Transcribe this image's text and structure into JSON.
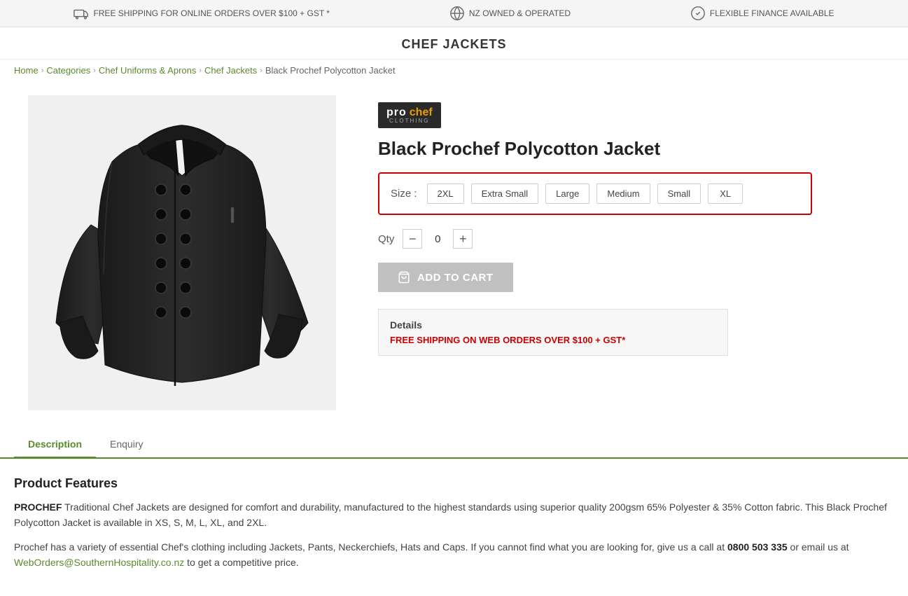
{
  "topbar": {
    "items": [
      {
        "id": "shipping",
        "icon": "truck-icon",
        "text": "FREE SHIPPING FOR ONLINE ORDERS OVER $100 + GST *"
      },
      {
        "id": "nz-owned",
        "icon": "globe-icon",
        "text": "NZ OWNED & OPERATED"
      },
      {
        "id": "finance",
        "icon": "check-circle-icon",
        "text": "FLEXIBLE FINANCE AVAILABLE"
      }
    ]
  },
  "page": {
    "title": "CHEF JACKETS"
  },
  "breadcrumb": {
    "items": [
      {
        "label": "Home",
        "href": "#"
      },
      {
        "label": "Categories",
        "href": "#"
      },
      {
        "label": "Chef Uniforms & Aprons",
        "href": "#"
      },
      {
        "label": "Chef Jackets",
        "href": "#"
      },
      {
        "label": "Black Prochef Polycotton Jacket",
        "href": null
      }
    ]
  },
  "product": {
    "brand": {
      "pro": "pro",
      "chef": "chef",
      "clothing": "CLOTHING"
    },
    "title": "Black Prochef Polycotton Jacket",
    "sizes": [
      {
        "label": "2XL",
        "selected": false
      },
      {
        "label": "Extra Small",
        "selected": false
      },
      {
        "label": "Large",
        "selected": false
      },
      {
        "label": "Medium",
        "selected": false
      },
      {
        "label": "Small",
        "selected": false
      },
      {
        "label": "XL",
        "selected": false
      }
    ],
    "size_label": "Size :",
    "qty_label": "Qty",
    "qty_value": "0",
    "add_to_cart_label": "ADD TO CART",
    "details": {
      "title": "Details",
      "shipping_text": "FREE SHIPPING ON WEB ORDERS OVER $100 + GST*"
    }
  },
  "tabs": [
    {
      "label": "Description",
      "active": true
    },
    {
      "label": "Enquiry",
      "active": false
    }
  ],
  "description": {
    "section_title": "Product Features",
    "para1_bold": "PROCHEF",
    "para1_rest": " Traditional Chef Jackets are designed for comfort and durability, manufactured to the highest standards using superior quality 200gsm 65% Polyester & 35% Cotton fabric. This Black Prochef Polycotton Jacket is available in XS, S, M, L, XL, and 2XL.",
    "para2": "Prochef has a variety of essential Chef's clothing including Jackets, Pants, Neckerchiefs, Hats and Caps. If you cannot find what you are looking for, give us a call at ",
    "phone": "0800 503 335",
    "para2_mid": " or email us at ",
    "email": "WebOrders@SouthernHospitality.co.nz",
    "para2_end": " to get a competitive price."
  }
}
